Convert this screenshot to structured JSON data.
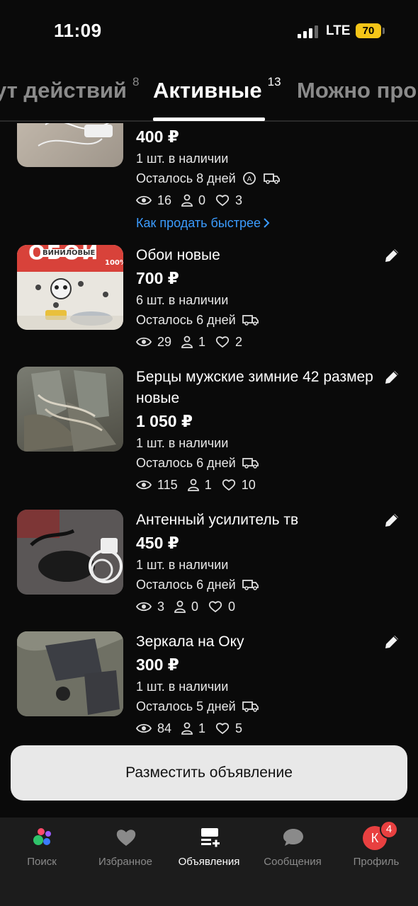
{
  "status_bar": {
    "time": "11:09",
    "network": "LTE",
    "battery": "70"
  },
  "tabs": [
    {
      "label": "ут действий",
      "count": "8"
    },
    {
      "label": "Активные",
      "count": "13"
    },
    {
      "label": "Можно про",
      "count": ""
    }
  ],
  "listings": [
    {
      "title": "",
      "price": "400 ₽",
      "stock": "1 шт. в наличии",
      "days_left": "Осталось 8 дней",
      "views": "16",
      "contacts": "0",
      "favorites": "3",
      "sell_faster": "Как продать быстрее"
    },
    {
      "title": "Обои новые",
      "price": "700 ₽",
      "stock": "6 шт. в наличии",
      "days_left": "Осталось 6 дней",
      "views": "29",
      "contacts": "1",
      "favorites": "2",
      "thumb_text_1": "ОБОИ",
      "thumb_text_2": "ВИНИЛОВЫЕ",
      "thumb_text_3": "100%"
    },
    {
      "title": "Берцы мужские зимние 42 размер новые",
      "price": "1 050 ₽",
      "stock": "1 шт. в наличии",
      "days_left": "Осталось 6 дней",
      "views": "115",
      "contacts": "1",
      "favorites": "10"
    },
    {
      "title": "Антенный усилитель тв",
      "price": "450 ₽",
      "stock": "1 шт. в наличии",
      "days_left": "Осталось 6 дней",
      "views": "3",
      "contacts": "0",
      "favorites": "0"
    },
    {
      "title": "Зеркала на Оку",
      "price": "300 ₽",
      "stock": "1 шт. в наличии",
      "days_left": "Осталось 5 дней",
      "views": "84",
      "contacts": "1",
      "favorites": "5"
    }
  ],
  "post_button": "Разместить объявление",
  "nav": [
    {
      "label": "Поиск",
      "icon": "search-dots-icon"
    },
    {
      "label": "Избранное",
      "icon": "heart-icon"
    },
    {
      "label": "Объявления",
      "icon": "listings-add-icon"
    },
    {
      "label": "Сообщения",
      "icon": "chat-icon"
    },
    {
      "label": "Профиль",
      "icon": "avatar",
      "avatar_letter": "К",
      "badge": "4"
    }
  ],
  "colors": {
    "accent_link": "#3b9cff",
    "badge": "#e84040",
    "battery": "#f5c518"
  }
}
